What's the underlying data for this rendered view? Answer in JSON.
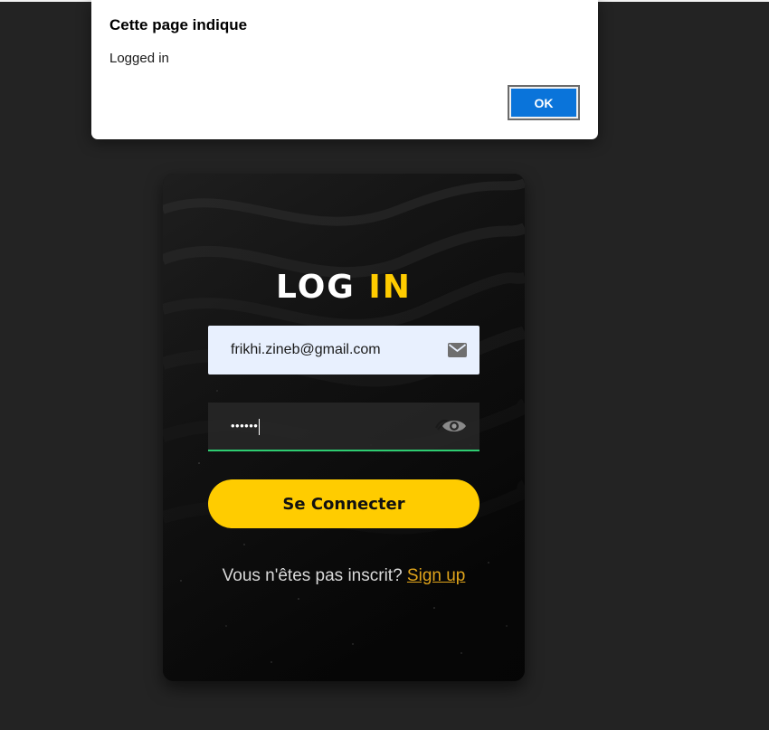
{
  "dialog": {
    "title": "Cette page indique",
    "message": "Logged in",
    "ok_label": "OK"
  },
  "login": {
    "title_word_1": "LOG",
    "title_word_2": "IN",
    "email_value": "frikhi.zineb@gmail.com",
    "password_value": "••••••",
    "email_icon": "envelope-icon",
    "password_icon": "eye-icon",
    "submit_label": "Se Connecter",
    "signup_prompt": "Vous n'êtes pas inscrit? ",
    "signup_link": "Sign up"
  },
  "colors": {
    "page_background": "#232323",
    "accent": "#ffcc00",
    "link": "#e0a41b",
    "focus_underline": "#2ecc71",
    "dialog_button": "#0a74da",
    "email_field_background": "#e8f0fe"
  }
}
